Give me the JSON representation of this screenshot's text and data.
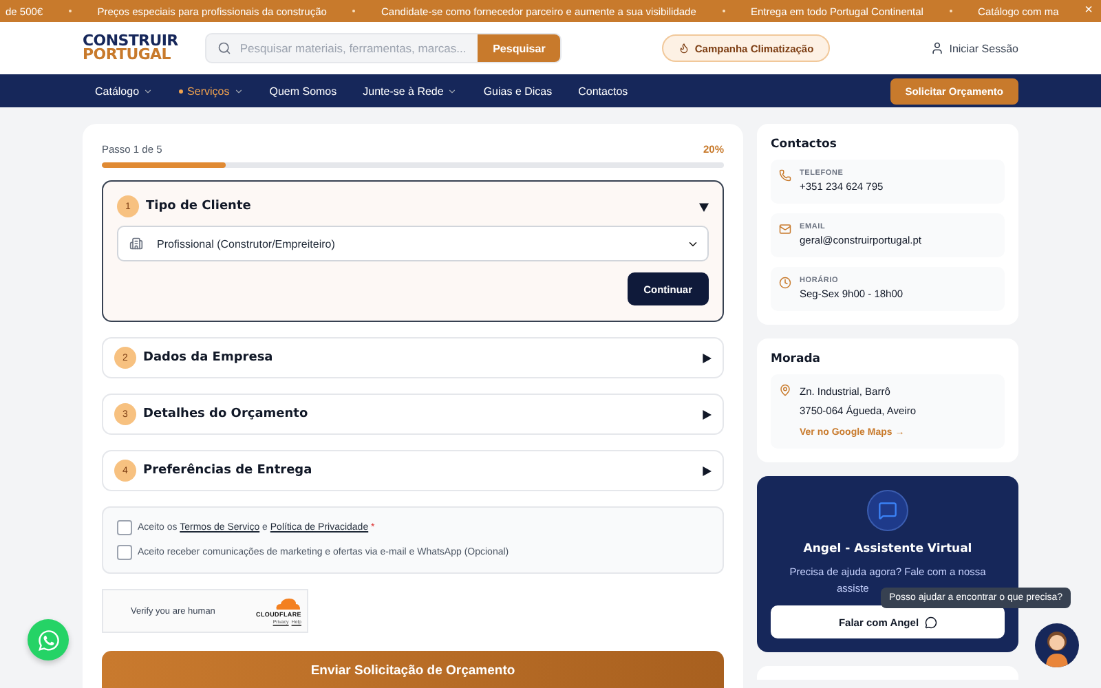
{
  "announcement": {
    "items": [
      "de 500€",
      "Preços especiais para profissionais da construção",
      "Candidate-se como fornecedor parceiro e aumente a sua visibilidade",
      "Entrega em todo Portugal Continental",
      "Catálogo com ma"
    ],
    "close": "×"
  },
  "header": {
    "logo": [
      "CONSTRUIR",
      "PORTUGAL"
    ],
    "search_placeholder": "Pesquisar materiais, ferramentas, marcas...",
    "search_button": "Pesquisar",
    "campaign": "Campanha Climatização",
    "login": "Iniciar Sessão"
  },
  "nav": {
    "items": [
      {
        "label": "Catálogo",
        "selected": false,
        "dropdown": true
      },
      {
        "label": "Serviços",
        "selected": true,
        "dropdown": true
      },
      {
        "label": "Quem Somos",
        "selected": false,
        "dropdown": false
      },
      {
        "label": "Junte-se à Rede",
        "selected": false,
        "dropdown": true
      },
      {
        "label": "Guias e Dicas",
        "selected": false,
        "dropdown": false
      },
      {
        "label": "Contactos",
        "selected": false,
        "dropdown": false
      }
    ],
    "cta": "Solicitar Orçamento"
  },
  "form": {
    "step_label": "Passo 1 de 5",
    "percent": "20%",
    "level": 0.2,
    "steps": [
      {
        "number": "1",
        "title": "Tipo de Cliente",
        "expanded": true
      },
      {
        "number": "2",
        "title": "Dados da Empresa",
        "expanded": false
      },
      {
        "number": "3",
        "title": "Detalhes do Orçamento",
        "expanded": false
      },
      {
        "number": "4",
        "title": "Preferências de Entrega",
        "expanded": false
      }
    ],
    "select_value": "Profissional (Construtor/Empreiteiro)",
    "continue_button": "Continuar",
    "consents": [
      {
        "checked": false,
        "segments": [
          {
            "kind": "text",
            "text": "Aceito os "
          },
          {
            "kind": "link",
            "text": "Termos de Serviço"
          },
          {
            "kind": "text",
            "text": " e "
          },
          {
            "kind": "link",
            "text": "Política de Privacidade"
          },
          {
            "kind": "required",
            "text": " *"
          }
        ]
      },
      {
        "checked": false,
        "segments": [
          {
            "kind": "text",
            "text": "Aceito receber comunicações de marketing e ofertas via e-mail e WhatsApp (Opcional)"
          }
        ]
      }
    ],
    "captcha": {
      "label": "Verify you are human",
      "brand": "CLOUDFLARE",
      "links": [
        "Privacy",
        "Help"
      ]
    },
    "submit_button": "Enviar Solicitação de Orçamento"
  },
  "sidebar": {
    "contacts": {
      "title": "Contactos",
      "items": [
        {
          "kind": "phone",
          "label": "TELEFONE",
          "value": "+351 234 624 795"
        },
        {
          "kind": "email",
          "label": "EMAIL",
          "value": "geral@construirportugal.pt"
        },
        {
          "kind": "clock",
          "label": "HORÁRIO",
          "value": "Seg-Sex 9h00 - 18h00"
        }
      ]
    },
    "address": {
      "title": "Morada",
      "lines": [
        "Zn. Industrial, Barrô",
        "3750-064 Águeda, Aveiro"
      ],
      "link": "Ver no Google Maps →"
    },
    "assistant": {
      "title": "Angel - Assistente Virtual",
      "text_lines": [
        "Precisa de ajuda agora? Fale com a nossa",
        "assiste"
      ],
      "button": "Falar com Angel",
      "tooltip": "Posso ajudar a encontrar o que precisa?"
    }
  }
}
